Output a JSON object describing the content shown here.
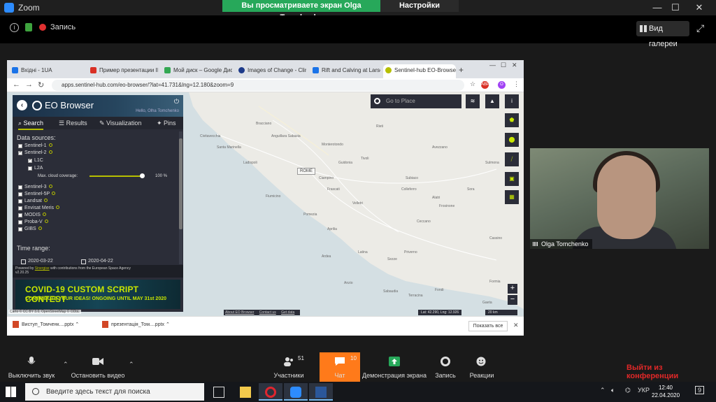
{
  "zoom": {
    "app_title": "Zoom",
    "share_banner": "Вы просматриваете экран Olga Tomchenko",
    "view_settings": "Настройки просмотра",
    "recording_label": "Запись",
    "gallery_label": "Вид галереи"
  },
  "browser": {
    "tabs": [
      {
        "label": "Вхідні - 1UA",
        "color": "#1a73e8"
      },
      {
        "label": "Пример презентации II",
        "color": "#d93025"
      },
      {
        "label": "Мой диск – Google Дис",
        "color": "#34a853"
      },
      {
        "label": "Images of Change - Clir",
        "color": "#1d3a8a"
      },
      {
        "label": "Rift and Calving at Larse",
        "color": "#1a73e8"
      },
      {
        "label": "Sentinel-hub EO-Browse",
        "color": "#b6bf00"
      }
    ],
    "url": "apps.sentinel-hub.com/eo-browser/?lat=41.731&lng=12.180&zoom=9"
  },
  "eo": {
    "title": "EO Browser",
    "user": "Hello, Olha Tomchenko",
    "tabs": [
      "Search",
      "Results",
      "Visualization",
      "Pins"
    ],
    "data_sources_label": "Data sources:",
    "sources": [
      {
        "label": "Sentinel-1",
        "checked": false
      },
      {
        "label": "Sentinel-2",
        "checked": true
      }
    ],
    "sub_sources": [
      {
        "label": "L1C",
        "checked": true
      },
      {
        "label": "L2A",
        "checked": false
      }
    ],
    "cloud_label": "Max. cloud coverage:",
    "cloud_value": "100 %",
    "cloud_fraction": 1.0,
    "more_sources": [
      "Sentinel-3",
      "Sentinel-5P",
      "Landsat",
      "Envisat Meris",
      "MODIS",
      "Proba-V",
      "GIBS"
    ],
    "time_range_label": "Time range:",
    "date_from": "2020-03-22",
    "date_to": "2020-04-22",
    "powered_prefix": "Powered by",
    "powered_link": "Sinergise",
    "powered_suffix": "with contributions from the European Space Agency",
    "version": "v2.20.25",
    "contest_line1": "COVID-19 CUSTOM SCRIPT CONTEST",
    "contest_line2": "CONTRIBUTE YOUR IDEAS! ONGOING UNTIL MAY 31st 2020"
  },
  "map": {
    "search_placeholder": "Go to Place",
    "city": "ROME",
    "places": [
      "Civitavecchia",
      "Santa Marinella",
      "Ladispoli",
      "Anguillara Sabazia",
      "Bracciano",
      "Monterotondo",
      "Guidonia",
      "Tivoli",
      "Frascati",
      "Fiumicino",
      "Ciampino",
      "Velletri",
      "Anzio",
      "Latina",
      "Aprilia",
      "Pomezia",
      "Ardea",
      "Colleferro",
      "Frosinone",
      "Alatri",
      "Sezze",
      "Priverno",
      "Sora",
      "Terracina",
      "Fondi",
      "Sabaudia",
      "Gaeta",
      "Formia",
      "Cassino",
      "Avezzano",
      "Sulmona",
      "Rieti",
      "Subiaco",
      "Ceccano"
    ],
    "attribution": "Carto © CC BY 3.0, OpenStreetMap © ODbL",
    "about": "About EO Browser",
    "contact": "Contact us",
    "get_data": "Get data",
    "latlng": "Lat: 42.290, Lng: 12.926",
    "scale": "20 km"
  },
  "downloads": {
    "items": [
      "Виступ_Томченк....pptx",
      "презентація_Том....pptx"
    ],
    "show_all": "Показать все"
  },
  "participant": {
    "name": "Olga Tomchenko"
  },
  "toolbar": {
    "mute": "Выключить звук",
    "stop_video": "Остановить видео",
    "participants": "Участники",
    "participants_count": "51",
    "chat": "Чат",
    "chat_count": "10",
    "share": "Демонстрация экрана",
    "record": "Запись",
    "reactions": "Реакции",
    "leave": "Выйти из конференции"
  },
  "taskbar": {
    "search_placeholder": "Введите здесь текст для поиска",
    "lang": "УКР",
    "time": "12:40",
    "date": "22.04.2020",
    "notif_count": "9"
  }
}
